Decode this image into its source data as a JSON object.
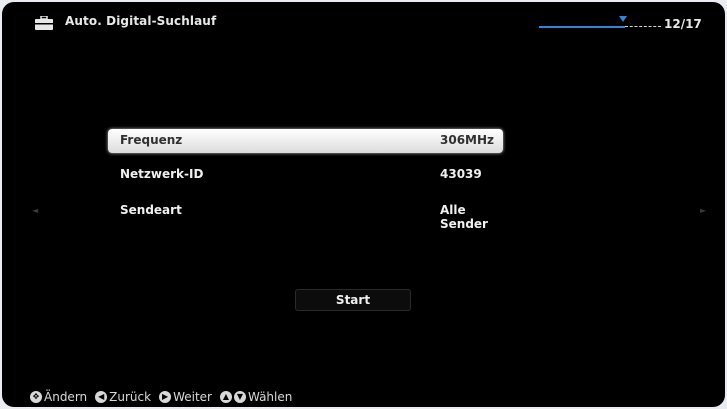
{
  "header": {
    "title": "Auto. Digital-Suchlauf",
    "page_counter": "12/17",
    "progress": 0.7
  },
  "settings": [
    {
      "label": "Frequenz",
      "value": "306MHz",
      "selected": true
    },
    {
      "label": "Netzwerk-ID",
      "value": "43039",
      "selected": false
    },
    {
      "label": "Sendeart",
      "value": "Alle Sender",
      "selected": false
    }
  ],
  "start_button": "Start",
  "side_arrows": {
    "left": "◄",
    "right": "►"
  },
  "footer": {
    "change": "Ändern",
    "back": "Zurück",
    "next": "Weiter",
    "select": "Wählen"
  },
  "colors": {
    "accent": "#2f86d8",
    "background": "#000000",
    "selected_row": "#f5f5f5"
  },
  "icons": [
    "toolbox-icon",
    "dpad-icon",
    "arrow-left-icon",
    "arrow-right-icon",
    "arrow-up-icon",
    "arrow-down-icon"
  ]
}
